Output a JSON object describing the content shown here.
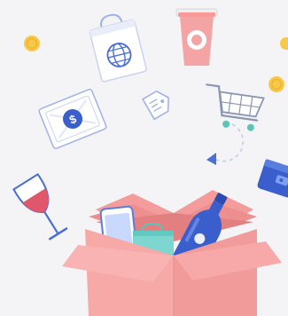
{
  "illustration": {
    "background": "#f4f4f6",
    "icons": [
      "coin-icon",
      "shopping-bag-icon",
      "coffee-cup-icon",
      "banknote-icon",
      "price-tag-icon",
      "shopping-cart-icon",
      "wallet-icon",
      "wine-glass-icon",
      "open-box-icon",
      "phone-icon",
      "wine-bottle-icon"
    ],
    "banknote_symbol": "$",
    "colors": {
      "box_pink": "#f7a9a8",
      "box_dark_pink": "#ee8f8f",
      "outline_blue": "#4a6fd3",
      "coin_yellow": "#f7c948",
      "cup_pink": "#f4a4a4",
      "cart_teal": "#5cc3b8",
      "bottle_blue": "#3a5fcc",
      "wine_red": "#e0566a",
      "bag_teal": "#7ed6d0"
    }
  }
}
